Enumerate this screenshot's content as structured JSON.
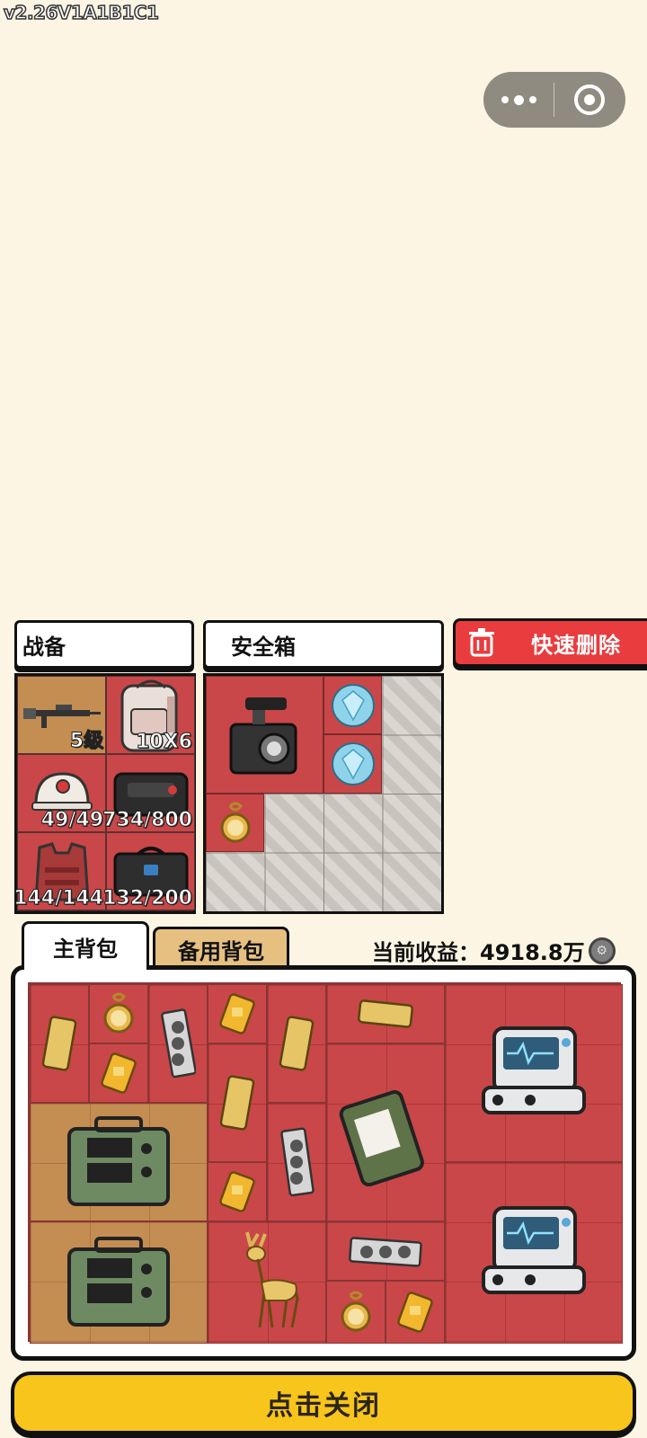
{
  "version": "v2.26V1A1B1C1",
  "capsule": {
    "more_icon": "more-dots-icon",
    "close_icon": "target-circle-icon"
  },
  "loadout": {
    "title": "战备",
    "items": [
      {
        "name": "rifle",
        "value": "5级"
      },
      {
        "name": "backpack",
        "value": "10X6"
      },
      {
        "name": "helmet",
        "value": "49/49"
      },
      {
        "name": "chest-rig",
        "value": "734/800"
      },
      {
        "name": "armor-vest",
        "value": "144/144"
      },
      {
        "name": "secure-case",
        "value": "132/200"
      }
    ]
  },
  "safe_box": {
    "title": "安全箱",
    "items": [
      "camera",
      "diamond",
      "diamond",
      "pocket-watch"
    ]
  },
  "quick_delete": {
    "label": "快速删除",
    "icon": "trash-icon"
  },
  "tabs": {
    "main": "主背包",
    "spare": "备用背包",
    "active": "main"
  },
  "earnings": {
    "label": "当前收益：",
    "value": "4918.8万"
  },
  "backpack_items": [
    "gold-bar",
    "pocket-watch",
    "graphics-card",
    "gold-card",
    "gold-bar",
    "gold-ingot",
    "medical-monitor",
    "gold-card",
    "gold-bar",
    "field-radio",
    "military-laptop",
    "graphics-card",
    "gold-card",
    "field-radio",
    "golden-deer",
    "graphics-card",
    "pocket-watch",
    "gold-card",
    "medical-monitor"
  ],
  "close_button": "点击关闭",
  "colors": {
    "slot_red": "#c94748",
    "slot_tan": "#c48d52",
    "button_yellow": "#f7c51b",
    "delete_red": "#e83c3e"
  }
}
